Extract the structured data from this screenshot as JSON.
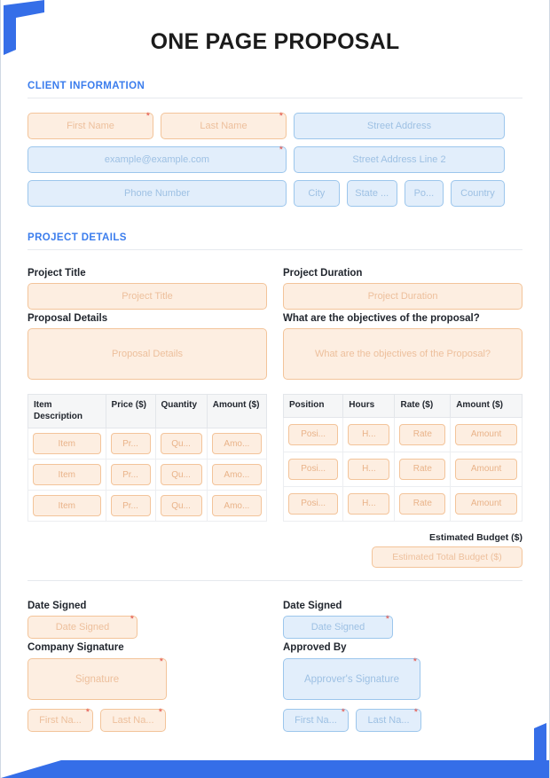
{
  "document": {
    "title": "ONE PAGE PROPOSAL"
  },
  "sections": {
    "client_information": {
      "heading": "CLIENT INFORMATION",
      "fields": {
        "first_name": "First Name",
        "last_name": "Last Name",
        "email": "example@example.com",
        "phone": "Phone Number",
        "street_address": "Street Address",
        "street_address_2": "Street Address Line 2",
        "city": "City",
        "state": "State ...",
        "postal": "Po...",
        "country": "Country"
      }
    },
    "project_details": {
      "heading": "PROJECT DETAILS",
      "project_title_label": "Project Title",
      "project_title_placeholder": "Project Title",
      "project_duration_label": "Project Duration",
      "project_duration_placeholder": "Project Duration",
      "proposal_details_label": "Proposal Details",
      "proposal_details_placeholder": "Proposal Details",
      "objectives_label": "What are the objectives of the proposal?",
      "objectives_placeholder": "What are the objectives of the Proposal?"
    }
  },
  "items_table": {
    "headers": [
      "Item Description",
      "Price ($)",
      "Quantity",
      "Amount ($)"
    ],
    "rows": [
      [
        "Item",
        "Pr...",
        "Qu...",
        "Amo..."
      ],
      [
        "Item",
        "Pr...",
        "Qu...",
        "Amo..."
      ],
      [
        "Item",
        "Pr...",
        "Qu...",
        "Amo..."
      ]
    ]
  },
  "labor_table": {
    "headers": [
      "Position",
      "Hours",
      "Rate ($)",
      "Amount ($)"
    ],
    "rows": [
      [
        "Posi...",
        "H...",
        "Rate",
        "Amount"
      ],
      [
        "Posi...",
        "H...",
        "Rate",
        "Amount"
      ],
      [
        "Posi...",
        "H...",
        "Rate",
        "Amount"
      ]
    ]
  },
  "budget": {
    "label": "Estimated Budget ($)",
    "placeholder": "Estimated Total Budget ($)"
  },
  "signature": {
    "company": {
      "date_label": "Date Signed",
      "date_placeholder": "Date Signed",
      "signature_label": "Company Signature",
      "signature_placeholder": "Signature",
      "first_name": "First Na...",
      "last_name": "Last Na..."
    },
    "approver": {
      "date_label": "Date Signed",
      "date_placeholder": "Date Signed",
      "signature_label": "Approved By",
      "signature_placeholder": "Approver's Signature",
      "first_name": "First Na...",
      "last_name": "Last Na..."
    }
  },
  "colors": {
    "accent_blue": "#356ee8",
    "heading_blue": "#3b7ded",
    "peach_fill": "#fdeee1",
    "peach_border": "#f3c49a",
    "blue_fill": "#e2eefb",
    "blue_border": "#9cc6ec",
    "required_red": "#e2524a"
  }
}
